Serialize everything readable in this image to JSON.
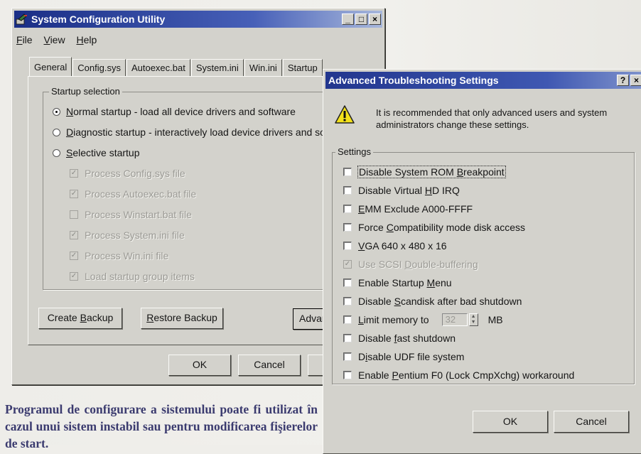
{
  "main_window": {
    "title": "System Configuration Utility",
    "menu": [
      {
        "label": "File",
        "u": "F",
        "rest": "ile"
      },
      {
        "label": "View",
        "u": "V",
        "rest": "iew"
      },
      {
        "label": "Help",
        "u": "H",
        "rest": "elp"
      }
    ],
    "tabs": [
      "General",
      "Config.sys",
      "Autoexec.bat",
      "System.ini",
      "Win.ini",
      "Startup"
    ],
    "active_tab": "General",
    "startup_group": "Startup selection",
    "radios": [
      {
        "u": "N",
        "rest": "ormal startup - load all device drivers and software",
        "selected": true
      },
      {
        "u": "D",
        "rest": "iagnostic startup - interactively load device drivers and softwar",
        "selected": false
      },
      {
        "u": "S",
        "rest": "elective startup",
        "selected": false
      }
    ],
    "selective_items": [
      {
        "label": "Process Config.sys file",
        "checked": true
      },
      {
        "label": "Process Autoexec.bat file",
        "checked": true
      },
      {
        "label": "Process Winstart.bat file",
        "checked": false
      },
      {
        "label": "Process System.ini file",
        "checked": true
      },
      {
        "label": "Process Win.ini file",
        "checked": true
      },
      {
        "label": "Load startup group items",
        "checked": true
      }
    ],
    "create_backup": {
      "pre": "Create ",
      "u": "B",
      "rest": "ackup"
    },
    "restore_backup": {
      "pre": "",
      "u": "R",
      "rest": "estore Backup"
    },
    "advanced_btn": "Advan",
    "ok": "OK",
    "cancel": "Cancel"
  },
  "advanced_dialog": {
    "title": "Advanced Troubleshooting Settings",
    "warning": "It is recommended that only advanced users and system administrators change these settings.",
    "settings_group": "Settings",
    "options": [
      {
        "pre": "Disable System ROM ",
        "u": "B",
        "rest": "reakpoint",
        "checked": false,
        "disabled": false
      },
      {
        "pre": "Disable Virtual ",
        "u": "H",
        "rest": "D IRQ",
        "checked": false,
        "disabled": false
      },
      {
        "pre": "",
        "u": "E",
        "rest": "MM Exclude A000-FFFF",
        "checked": false,
        "disabled": false
      },
      {
        "pre": "Force ",
        "u": "C",
        "rest": "ompatibility mode disk access",
        "checked": false,
        "disabled": false
      },
      {
        "pre": "",
        "u": "V",
        "rest": "GA 640 x 480 x 16",
        "checked": false,
        "disabled": false
      },
      {
        "pre": "Use SCSI ",
        "u": "D",
        "rest": "ouble-buffering",
        "checked": true,
        "disabled": true
      },
      {
        "pre": "Enable Startup ",
        "u": "M",
        "rest": "enu",
        "checked": false,
        "disabled": false
      },
      {
        "pre": "Disable ",
        "u": "S",
        "rest": "candisk after bad shutdown",
        "checked": false,
        "disabled": false
      },
      {
        "pre": "",
        "u": "L",
        "rest": "imit memory to",
        "checked": false,
        "disabled": false
      },
      {
        "pre": "Disable ",
        "u": "f",
        "rest": "ast shutdown",
        "checked": false,
        "disabled": false
      },
      {
        "pre": "D",
        "u": "i",
        "rest": "sable UDF file system",
        "checked": false,
        "disabled": false
      },
      {
        "pre": "Enable ",
        "u": "P",
        "rest": "entium F0 (Lock CmpXchg) workaround",
        "checked": false,
        "disabled": false
      }
    ],
    "memory_value": "32",
    "memory_unit": "MB",
    "ok": "OK",
    "cancel": "Cancel"
  },
  "caption": "Programul de configurare a sistemului poate fi utilizat în cazul unui sistem instabil sau pentru modificarea fişierelor de start."
}
